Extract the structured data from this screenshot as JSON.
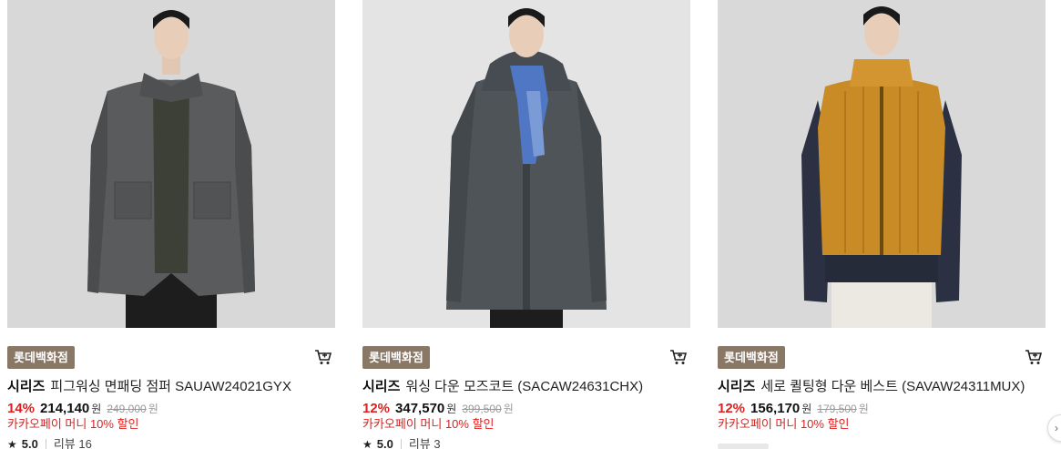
{
  "products": [
    {
      "badge": "롯데백화점",
      "brand": "시리즈",
      "name": "피그워싱 면패딩 점퍼 SAUAW24021GYX",
      "discount": "14%",
      "sale_price": "214,140",
      "currency": "원",
      "original_price": "249,000",
      "promo": "카카오페이 머니 10% 할인",
      "rating": "5.0",
      "review_label": "리뷰 16",
      "image_icon": "jacket-photo",
      "garment_color": "#5a5b5c"
    },
    {
      "badge": "롯데백화점",
      "brand": "시리즈",
      "name": "워싱 다운 모즈코트 (SACAW24631CHX)",
      "discount": "12%",
      "sale_price": "347,570",
      "currency": "원",
      "original_price": "399,500",
      "promo": "카카오페이 머니 10% 할인",
      "rating": "5.0",
      "review_label": "리뷰 3",
      "image_icon": "coat-photo",
      "garment_color": "#4f5459"
    },
    {
      "badge": "롯데백화점",
      "brand": "시리즈",
      "name": "세로 퀼팅형 다운 베스트 (SAVAW24311MUX)",
      "discount": "12%",
      "sale_price": "156,170",
      "currency": "원",
      "original_price": "179,500",
      "promo": "카카오페이 머니 10% 할인",
      "image_icon": "vest-photo",
      "garment_color": "#c98b25"
    }
  ],
  "colors": {
    "badge_bg": "#8a7866",
    "discount_red": "#e0201e",
    "photo_bg": "#d9d9d9"
  },
  "icons": {
    "cart": "cart-icon",
    "star": "star-icon",
    "next": "chevron-right-icon"
  }
}
